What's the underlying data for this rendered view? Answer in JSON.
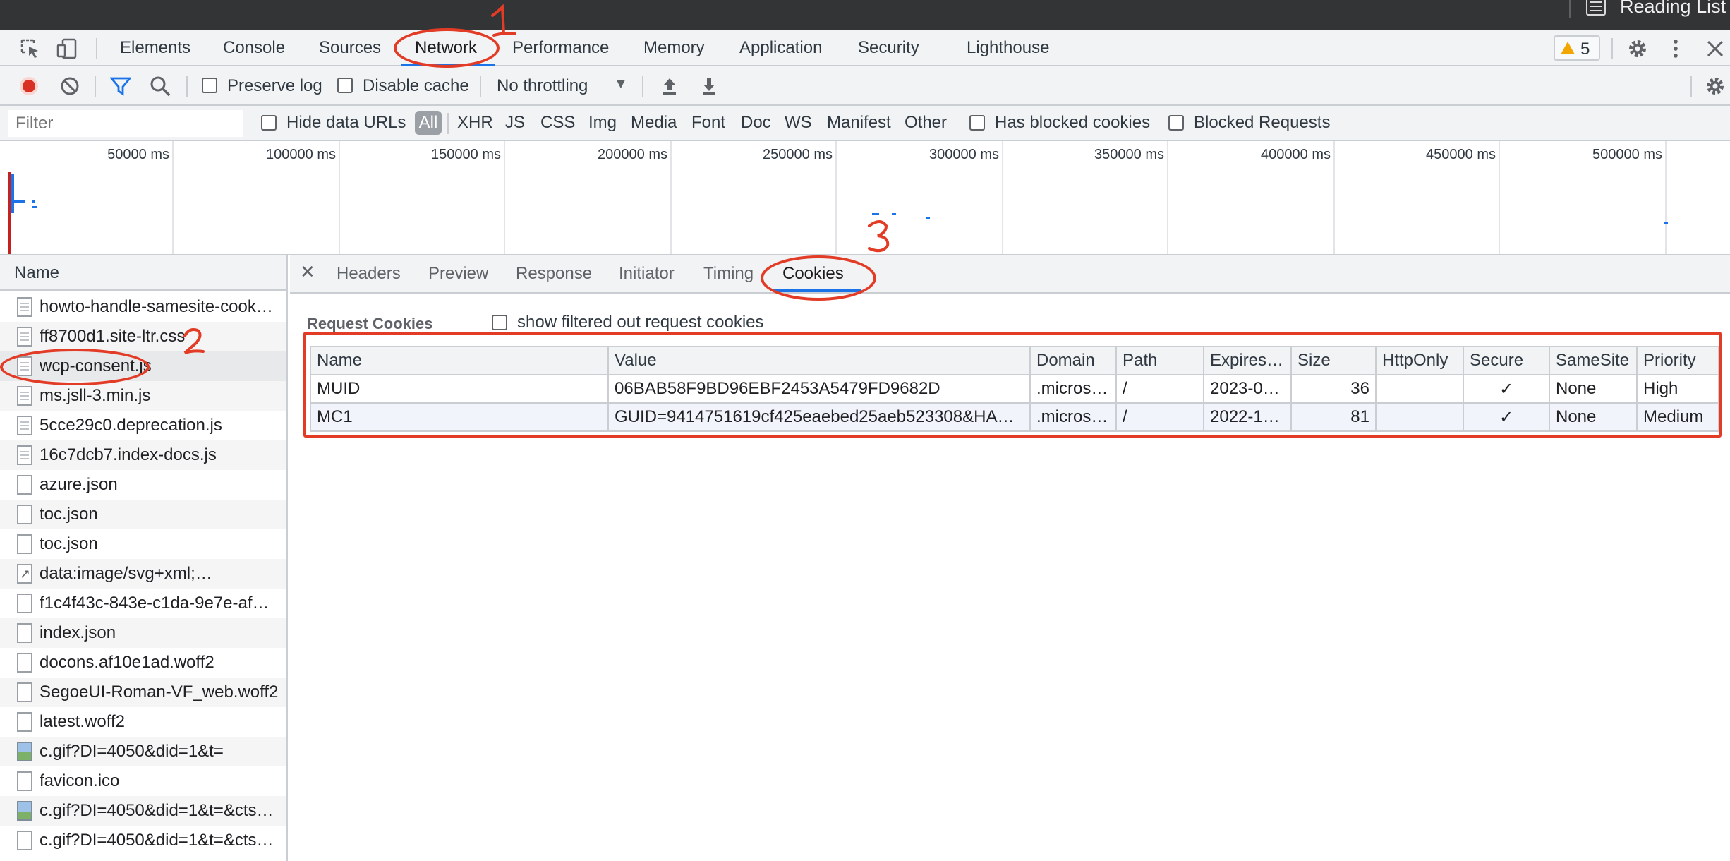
{
  "browser": {
    "reading_list_label": "Reading List"
  },
  "devtools": {
    "tabs": [
      "Elements",
      "Console",
      "Sources",
      "Network",
      "Performance",
      "Memory",
      "Application",
      "Security",
      "Lighthouse"
    ],
    "active_tab": "Network",
    "warning_count": "5"
  },
  "network_toolbar": {
    "preserve_log": "Preserve log",
    "disable_cache": "Disable cache",
    "throttling": "No throttling"
  },
  "filter_bar": {
    "placeholder": "Filter",
    "hide_data_urls": "Hide data URLs",
    "types": [
      "All",
      "XHR",
      "JS",
      "CSS",
      "Img",
      "Media",
      "Font",
      "Doc",
      "WS",
      "Manifest",
      "Other"
    ],
    "has_blocked_cookies": "Has blocked cookies",
    "blocked_requests": "Blocked Requests"
  },
  "overview": {
    "ticks": [
      "50000 ms",
      "100000 ms",
      "150000 ms",
      "200000 ms",
      "250000 ms",
      "300000 ms",
      "350000 ms",
      "400000 ms",
      "450000 ms",
      "500000 ms"
    ]
  },
  "request_list": {
    "header": "Name",
    "selected_index": 2,
    "items": [
      {
        "name": "howto-handle-samesite-cook…",
        "icon": "doc"
      },
      {
        "name": "ff8700d1.site-ltr.css",
        "icon": "doc"
      },
      {
        "name": "wcp-consent.js",
        "icon": "doc"
      },
      {
        "name": "ms.jsll-3.min.js",
        "icon": "doc"
      },
      {
        "name": "5cce29c0.deprecation.js",
        "icon": "doc"
      },
      {
        "name": "16c7dcb7.index-docs.js",
        "icon": "doc"
      },
      {
        "name": "azure.json",
        "icon": "blank"
      },
      {
        "name": "toc.json",
        "icon": "blank"
      },
      {
        "name": "toc.json",
        "icon": "blank"
      },
      {
        "name": "data:image/svg+xml;…",
        "icon": "svg"
      },
      {
        "name": "f1c4f43c-843e-c1da-9e7e-af…",
        "icon": "blank"
      },
      {
        "name": "index.json",
        "icon": "blank"
      },
      {
        "name": "docons.af10e1ad.woff2",
        "icon": "blank"
      },
      {
        "name": "SegoeUI-Roman-VF_web.woff2",
        "icon": "blank"
      },
      {
        "name": "latest.woff2",
        "icon": "blank"
      },
      {
        "name": "c.gif?DI=4050&did=1&t=",
        "icon": "img"
      },
      {
        "name": "favicon.ico",
        "icon": "blank"
      },
      {
        "name": "c.gif?DI=4050&did=1&t=&cts…",
        "icon": "img"
      },
      {
        "name": "c.gif?DI=4050&did=1&t=&cts…",
        "icon": "blank"
      }
    ]
  },
  "detail": {
    "tabs": [
      "Headers",
      "Preview",
      "Response",
      "Initiator",
      "Timing",
      "Cookies"
    ],
    "active_tab": "Cookies",
    "section_title": "Request Cookies",
    "show_filtered_label": "show filtered out request cookies",
    "cookie_table": {
      "headers": [
        "Name",
        "Value",
        "Domain",
        "Path",
        "Expires…",
        "Size",
        "HttpOnly",
        "Secure",
        "SameSite",
        "Priority"
      ],
      "rows": [
        [
          "MUID",
          "06BAB58F9BD96EBF2453A5479FD9682D",
          ".micros…",
          "/",
          "2023-0…",
          "36",
          "",
          "✓",
          "None",
          "High"
        ],
        [
          "MC1",
          "GUID=9414751619cf425eaebed25aeb523308&HA…",
          ".micros…",
          "/",
          "2022-1…",
          "81",
          "",
          "✓",
          "None",
          "Medium"
        ]
      ]
    }
  },
  "annotations": [
    "1",
    "2",
    "3"
  ],
  "colors": {
    "accent": "#1a73e8",
    "record": "#d93025",
    "annotation": "#e23b26",
    "warning": "#f2a600"
  }
}
